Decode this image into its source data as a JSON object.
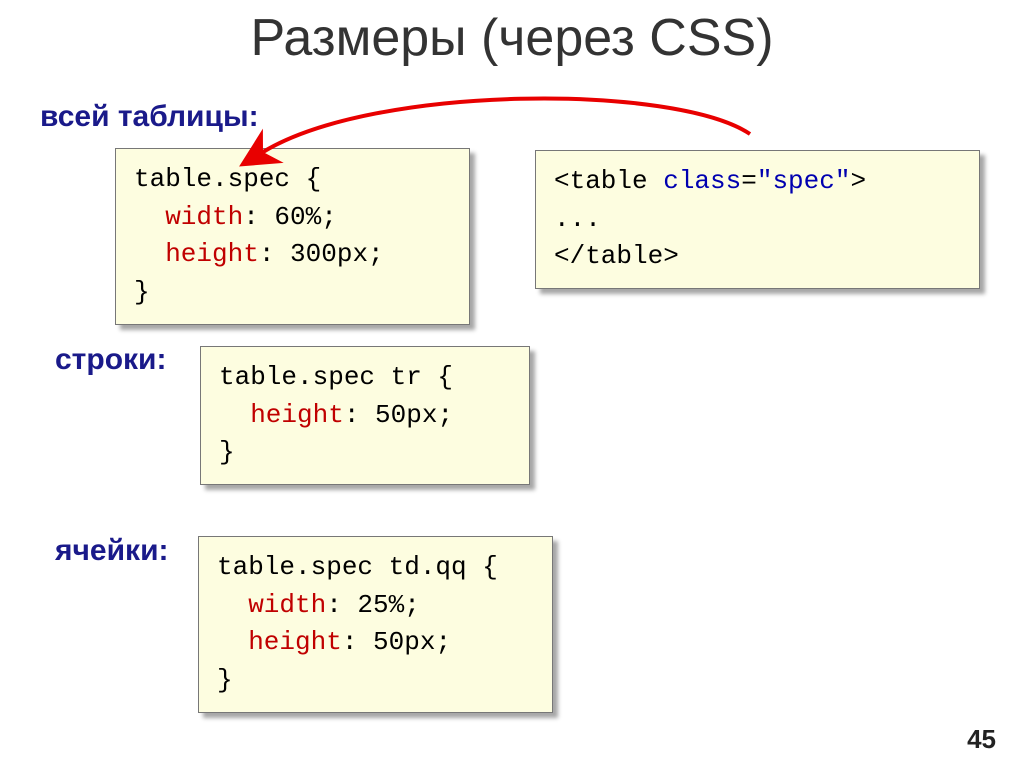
{
  "title": "Размеры (через CSS)",
  "labels": {
    "table": "всей таблицы:",
    "row": "строки:",
    "cell": "ячейки:"
  },
  "code": {
    "box1": {
      "sel": "table.spec {",
      "p1a": "width",
      "p1b": ": 60%;",
      "p2a": "height",
      "p2b": ": 300px;",
      "close": "}"
    },
    "box2": {
      "l1a": "<table ",
      "l1b": "class",
      "l1c": "=",
      "l1d": "\"spec\"",
      "l1e": ">",
      "l2": "...",
      "l3": "</table>"
    },
    "box3": {
      "sel": "table.spec tr {",
      "p1a": "height",
      "p1b": ": 50px;",
      "close": "}"
    },
    "box4": {
      "sel": "table.spec td.qq {",
      "p1a": "width",
      "p1b": ": 25%;",
      "p2a": "height",
      "p2b": ": 50px;",
      "close": "}"
    }
  },
  "page": "45"
}
